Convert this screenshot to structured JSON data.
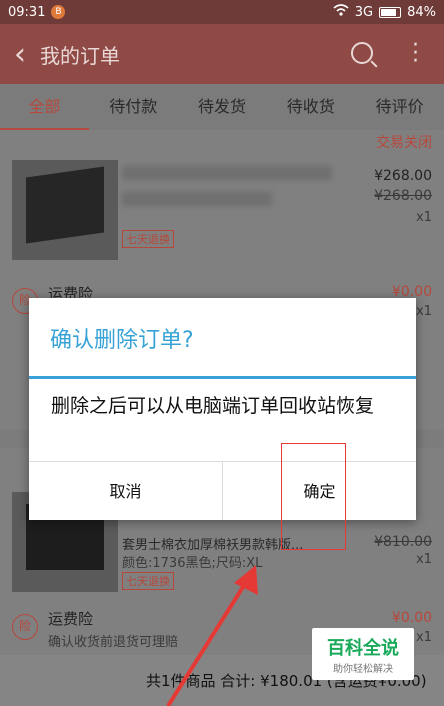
{
  "status_bar": {
    "time": "09:31",
    "notification_badge": "B",
    "network": "3G",
    "battery": "84%"
  },
  "header": {
    "title": "我的订单",
    "back_icon": "chevron-left-icon",
    "search_icon": "search-icon",
    "more_icon": "more-vertical-icon"
  },
  "tabs": [
    {
      "label": "全部",
      "active": true
    },
    {
      "label": "待付款",
      "active": false
    },
    {
      "label": "待发货",
      "active": false
    },
    {
      "label": "待收货",
      "active": false
    },
    {
      "label": "待评价",
      "active": false
    }
  ],
  "order1": {
    "status": "交易关闭",
    "price": "¥268.00",
    "original_price": "¥268.00",
    "quantity": "x1",
    "return_tag": "七天退换",
    "insurance_title": "运费险",
    "insurance_icon_text": "险",
    "insurance_price": "¥0.00",
    "insurance_qty": "x1"
  },
  "order2": {
    "title": "套男士棉衣加厚棉袄男款韩版...",
    "spec": "颜色:1736黑色;尺码:XL",
    "original_price": "¥810.00",
    "quantity": "x1",
    "return_tag": "七天退换",
    "insurance_title": "运费险",
    "insurance_desc": "确认收货前退货可理赔",
    "insurance_icon_text": "险",
    "insurance_price": "¥0.00",
    "insurance_qty": "x1"
  },
  "footer": {
    "summary": "共1件商品  合计: ¥180.01 (含运费¥0.00)"
  },
  "dialog": {
    "title": "确认删除订单?",
    "message": "删除之后可以从电脑端订单回收站恢复",
    "cancel_label": "取消",
    "confirm_label": "确定"
  },
  "watermark": {
    "title": "百科全说",
    "subtitle": "助你轻松解决"
  },
  "colors": {
    "accent": "#36a2d6",
    "brand_red": "#b7473b",
    "annotation": "#e53935",
    "watermark_green": "#19a95a"
  }
}
